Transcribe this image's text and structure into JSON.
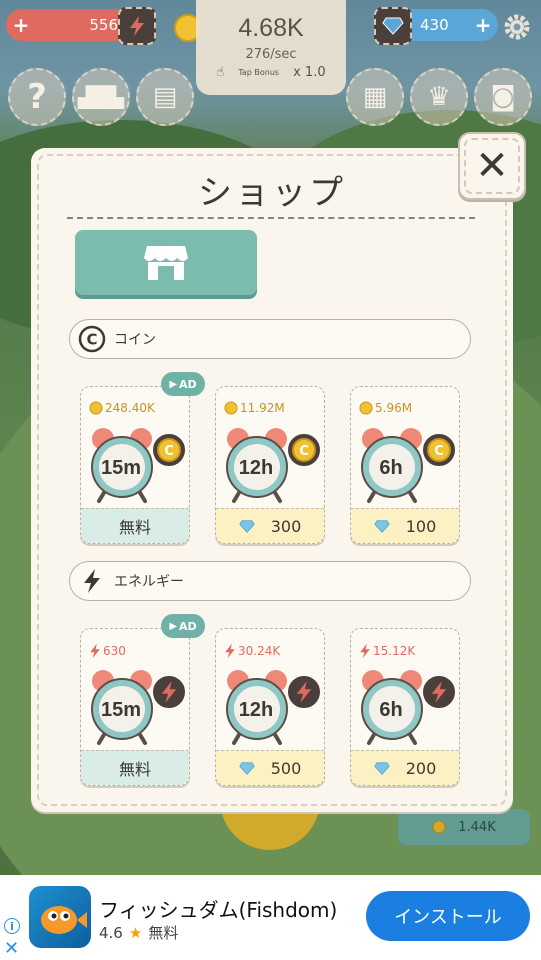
{
  "hud": {
    "energy_value": "556",
    "coin_total": "4.68K",
    "coin_rate": "276/sec",
    "tap_bonus_label": "Tap Bonus",
    "tap_multiplier": "x 1.0",
    "gem_value": "430"
  },
  "shop": {
    "title": "ショップ",
    "sections": {
      "coins": "コイン",
      "energy": "エネルギー"
    },
    "ad_label": "AD",
    "coin_items": [
      {
        "reward": "248.40K",
        "duration": "15m",
        "cost": "無料",
        "cost_type": "free"
      },
      {
        "reward": "11.92M",
        "duration": "12h",
        "cost": "300",
        "cost_type": "gem"
      },
      {
        "reward": "5.96M",
        "duration": "6h",
        "cost": "100",
        "cost_type": "gem"
      }
    ],
    "energy_items": [
      {
        "reward": "630",
        "duration": "15m",
        "cost": "無料",
        "cost_type": "free"
      },
      {
        "reward": "30.24K",
        "duration": "12h",
        "cost": "500",
        "cost_type": "gem"
      },
      {
        "reward": "15.12K",
        "duration": "6h",
        "cost": "200",
        "cost_type": "gem"
      }
    ]
  },
  "scene": {
    "bottom_coin_value": "1.44K"
  },
  "ad": {
    "title": "フィッシュダム(Fishdom)",
    "rating": "4.6",
    "price": "無料",
    "install_label": "インストール"
  },
  "colors": {
    "teal": "#7cbcae",
    "energy_red": "#e06a5f",
    "gem_blue": "#5aa6d8",
    "coin_gold": "#f0c231",
    "install_blue": "#1a7fe0"
  }
}
